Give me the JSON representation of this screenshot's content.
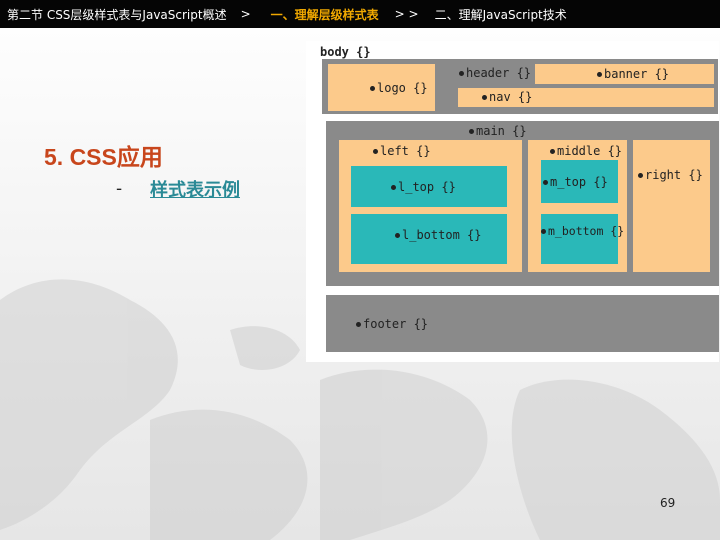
{
  "nav": {
    "item1": "第二节 CSS层级样式表与JavaScript概述",
    "sep1": ">",
    "item2": "一、理解层级样式表",
    "sep2": "> >",
    "item3": "二、理解JavaScript技术"
  },
  "slide": {
    "section_title": "5. CSS应用",
    "bullet_marker": "-",
    "bullet_text": "样式表示例",
    "page_number": "69"
  },
  "diagram": {
    "body_label": "body {}",
    "header_label": "header {}",
    "logo_label": "logo {}",
    "banner_label": "banner {}",
    "nav_label": "nav {}",
    "main_label": "main {}",
    "left_label": "left {}",
    "middle_label": "middle {}",
    "right_label": "right {}",
    "l_top_label": "l_top {}",
    "m_top_label": "m_top {}",
    "l_bottom_label": "l_bottom {}",
    "m_bottom_label": "m_bottom {}",
    "footer_label": "footer {}"
  },
  "colors": {
    "accent_orange": "#f0a800",
    "title_red": "#c8461c",
    "link_teal": "#2a8a96",
    "gray": "#8a8a8a",
    "tan": "#fcca8b",
    "teal": "#2ab8b8"
  }
}
